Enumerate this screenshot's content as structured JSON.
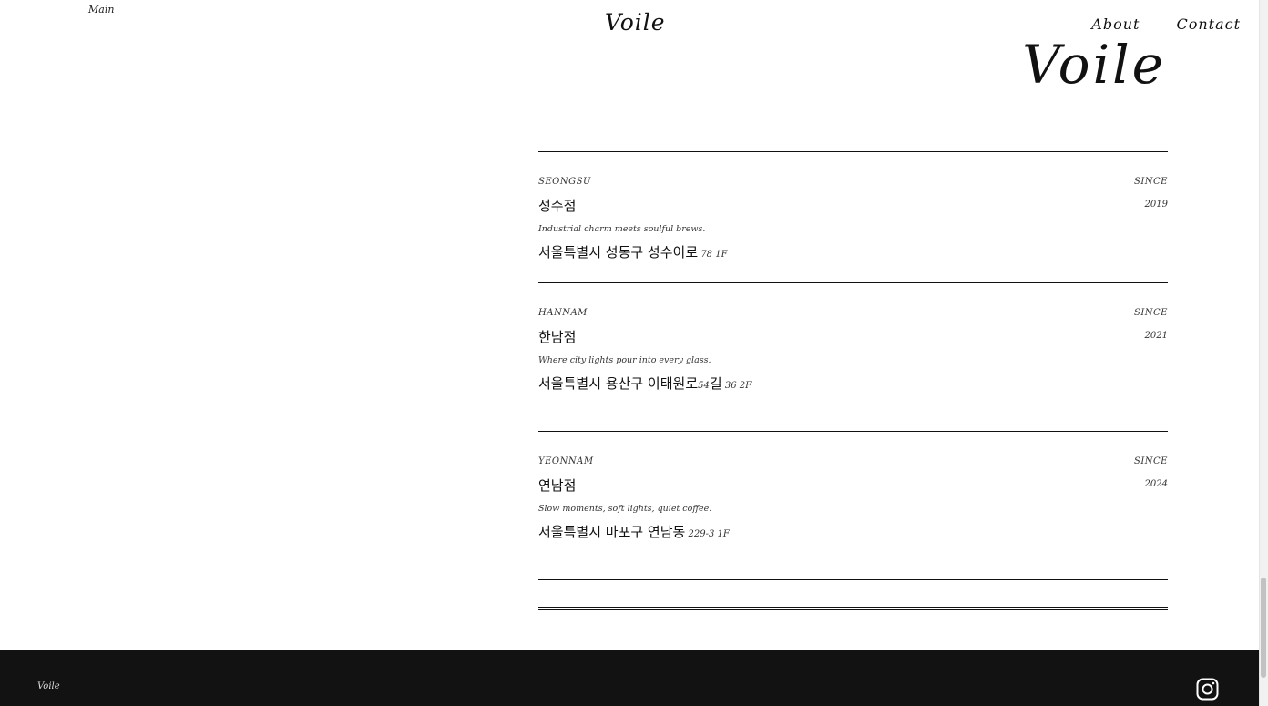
{
  "header": {
    "main_link": "Main",
    "logo": "Voile",
    "nav": {
      "about": "About",
      "contact": "Contact"
    }
  },
  "hero": {
    "title": "Voile"
  },
  "stores": [
    {
      "area": "SEONGSU",
      "name": "성수점",
      "since_label": "SINCE",
      "year": "2019",
      "tagline": "Industrial charm meets soulful brews.",
      "address": "서울특별시 성동구 성수이로",
      "address_detail": " 78 1F"
    },
    {
      "area": "HANNAM",
      "name": "한남점",
      "since_label": "SINCE",
      "year": "2021",
      "tagline": "Where city lights pour into every glass.",
      "address": "서울특별시 용산구 이태원로",
      "address_detail": "54",
      "address_suffix": "길",
      "address_detail2": " 36 2F"
    },
    {
      "area": "YEONNAM",
      "name": "연남점",
      "since_label": "SINCE",
      "year": "2024",
      "tagline": "Slow moments, soft lights, quiet coffee.",
      "address": "서울특별시 마포구 연남동",
      "address_detail": " 229-3 1F"
    }
  ],
  "footer": {
    "logo": "Voile",
    "social_icon": "instagram-icon"
  },
  "colors": {
    "text": "#111111",
    "footer_bg": "#121212",
    "background": "#ffffff"
  }
}
